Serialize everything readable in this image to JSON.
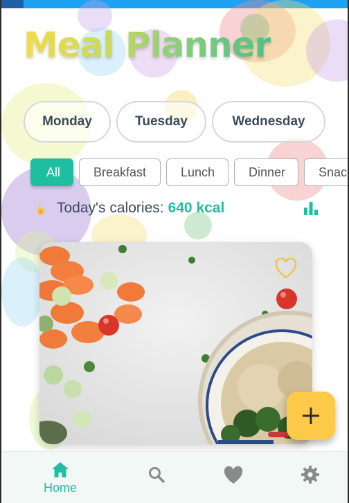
{
  "app": {
    "title": "Meal Planner"
  },
  "days": [
    {
      "label": "Monday"
    },
    {
      "label": "Tuesday"
    },
    {
      "label": "Wednesday"
    }
  ],
  "categories": [
    {
      "label": "All",
      "selected": true
    },
    {
      "label": "Breakfast",
      "selected": false
    },
    {
      "label": "Lunch",
      "selected": false
    },
    {
      "label": "Dinner",
      "selected": false
    },
    {
      "label": "Snacks",
      "selected": false
    }
  ],
  "calories": {
    "label": "Today's calories:",
    "value": "640 kcal",
    "icon": "flame-icon",
    "chart_icon": "bar-chart-icon"
  },
  "meal_card": {
    "favorite_icon": "heart-outline-icon",
    "image": "vegetables-and-grain-bowl-photo"
  },
  "fab": {
    "icon": "plus-icon"
  },
  "bottom_nav": {
    "items": [
      {
        "label": "Home",
        "icon": "home-icon",
        "active": true
      },
      {
        "label": "",
        "icon": "search-icon",
        "active": false
      },
      {
        "label": "",
        "icon": "heart-icon",
        "active": false
      },
      {
        "label": "",
        "icon": "gear-icon",
        "active": false
      }
    ]
  },
  "colors": {
    "accent": "#1ebfa0",
    "fab": "#ffc94a",
    "title_gradient_start": "#f2dc48",
    "title_gradient_end": "#4fbf8a",
    "nav_background": "#f1f8f6",
    "inactive_icon": "#8a8a8a"
  }
}
